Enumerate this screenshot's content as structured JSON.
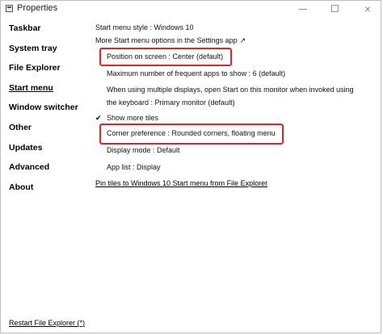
{
  "window": {
    "title": "Properties",
    "icons": {
      "app": "app-window-icon",
      "minimize": "minimize-icon",
      "maximize": "maximize-icon",
      "close": "close-icon",
      "close_glyph": "×"
    }
  },
  "sidebar": {
    "items": [
      {
        "label": "Taskbar"
      },
      {
        "label": "System tray"
      },
      {
        "label": "File Explorer"
      },
      {
        "label": "Start menu"
      },
      {
        "label": "Window switcher"
      },
      {
        "label": "Other"
      },
      {
        "label": "Updates"
      },
      {
        "label": "Advanced"
      },
      {
        "label": "About"
      }
    ],
    "active_index": 3
  },
  "main": {
    "start_menu_style": "Start menu style : Windows 10",
    "more_options_link": "More Start menu options in the Settings app",
    "more_options_icon": "external-link-icon",
    "more_options_glyph": "↗",
    "position_on_screen": "Position on screen : Center (default)",
    "max_frequent_apps": "Maximum number of frequent apps to show : 6 (default)",
    "multi_display_line1": "When using multiple displays, open Start on this monitor when invoked using",
    "multi_display_line2": "the keyboard : Primary monitor (default)",
    "show_more_tiles": "Show more tiles",
    "show_more_tiles_checked": true,
    "check_glyph": "✔",
    "corner_preference": "Corner preference : Rounded corners, floating menu",
    "display_mode": "Display mode : Default",
    "app_list": "App list : Display",
    "pin_tiles_link": "Pin tiles to Windows 10 Start menu from File Explorer"
  },
  "footer": {
    "restart_link": "Restart File Explorer (*)"
  },
  "colors": {
    "highlight_border": "#d22b2b"
  }
}
